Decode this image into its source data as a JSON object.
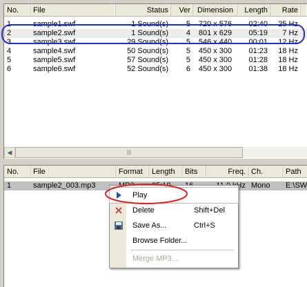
{
  "top_table": {
    "columns": [
      "No.",
      "File",
      "Status",
      "Ver",
      "Dimension",
      "Length",
      "Rate"
    ],
    "rows": [
      [
        "1",
        "sample1.swf",
        "1 Sound(s)",
        "5",
        "720 x 576",
        "02:40",
        "25 Hz"
      ],
      [
        "2",
        "sample2.swf",
        "1 Sound(s)",
        "4",
        "801 x 629",
        "05:19",
        "7 Hz"
      ],
      [
        "3",
        "sample3.swf",
        "29 Sound(s)",
        "5",
        "546 x 440",
        "00:01",
        "12 Hz"
      ],
      [
        "4",
        "sample4.swf",
        "50 Sound(s)",
        "5",
        "450 x 300",
        "01:23",
        "18 Hz"
      ],
      [
        "5",
        "sample5.swf",
        "57 Sound(s)",
        "5",
        "450 x 300",
        "01:28",
        "18 Hz"
      ],
      [
        "6",
        "sample6.swf",
        "52 Sound(s)",
        "6",
        "450 x 300",
        "01:38",
        "18 Hz"
      ]
    ],
    "scroll_thumb_glyph": "|||"
  },
  "bottom_table": {
    "columns": [
      "No.",
      "File",
      "Format",
      "Length",
      "Bits",
      "Freq.",
      "Ch.",
      "Path"
    ],
    "rows": [
      [
        "1",
        "sample2_003.mp3",
        "MP3",
        "05:19",
        "16",
        "11.0 kHz",
        "Mono",
        "E:\\SWF"
      ]
    ]
  },
  "context_menu": {
    "items": [
      {
        "label": "Play",
        "shortcut": "",
        "icon": "play-icon",
        "enabled": true
      },
      {
        "label": "Delete",
        "shortcut": "Shift+Del",
        "icon": "delete-icon",
        "enabled": true
      },
      {
        "label": "Save As...",
        "shortcut": "Ctrl+S",
        "icon": "save-icon",
        "enabled": true
      },
      {
        "label": "Browse Folder...",
        "shortcut": "",
        "icon": "",
        "enabled": true
      },
      {
        "label": "Merge MP3...",
        "shortcut": "",
        "icon": "",
        "enabled": false
      }
    ]
  },
  "colors": {
    "annotation": "#1b2fd6",
    "annotation_menu": "#e0201a",
    "play_icon": "#2f4fb0",
    "delete_icon": "#c0504d"
  }
}
